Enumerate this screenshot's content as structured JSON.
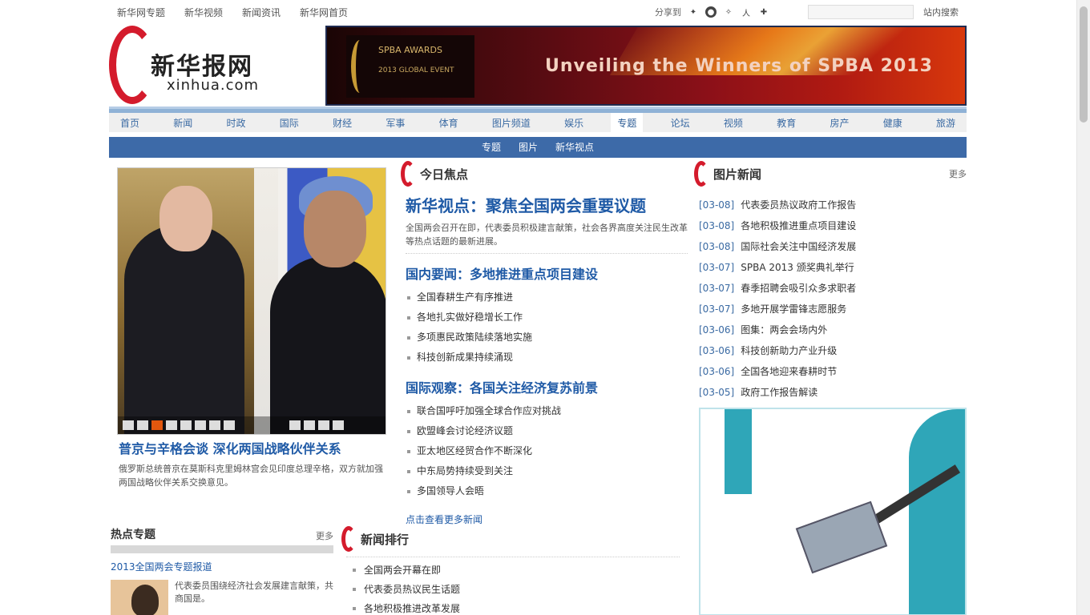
{
  "topbar": {
    "links": [
      "新华网专题",
      "新华视频",
      "新闻资讯",
      "新华网首页"
    ],
    "share_label": "分享到",
    "share_icons": [
      "sina-weibo-icon",
      "qq-icon",
      "tencent-weibo-icon",
      "renren-icon",
      "kaixin-icon"
    ],
    "search_placeholder": "",
    "search_label": "站内搜索"
  },
  "logo": {
    "cn": "新华报网",
    "en": "xinhua.com"
  },
  "banner": {
    "badge_title": "SPBA AWARDS",
    "badge_sub": "2013 GLOBAL EVENT",
    "title": "Unveiling the Winners of SPBA 2013"
  },
  "nav": {
    "items": [
      "首页",
      "新闻",
      "时政",
      "国际",
      "财经",
      "军事",
      "体育",
      "图片频道",
      "娱乐",
      "专题",
      "论坛",
      "视频",
      "教育",
      "房产",
      "健康",
      "旅游"
    ],
    "active": 9
  },
  "subnav": {
    "items": [
      "专题",
      "图片",
      "新华视点"
    ]
  },
  "photo": {
    "caption_title": "普京与辛格会谈 深化两国战略伙伴关系",
    "caption_desc": "俄罗斯总统普京在莫斯科克里姆林宫会见印度总理辛格，双方就加强两国战略伙伴关系交换意见。"
  },
  "center": {
    "section_title": "今日焦点",
    "headline": "新华视点：聚焦全国两会重要议题",
    "summary": "全国两会召开在即，代表委员积极建言献策，社会各界高度关注民生改革等热点话题的最新进展。",
    "sub1": "国内要闻：多地推进重点项目建设",
    "list1": [
      "全国春耕生产有序推进",
      "各地扎实做好稳增长工作",
      "多项惠民政策陆续落地实施",
      "科技创新成果持续涌现"
    ],
    "sub2": "国际观察：各国关注经济复苏前景",
    "list2": [
      "联合国呼吁加强全球合作应对挑战",
      "欧盟峰会讨论经济议题",
      "亚太地区经贸合作不断深化",
      "中东局势持续受到关注",
      "多国领导人会晤"
    ],
    "more": "点击查看更多新闻"
  },
  "right": {
    "section_title": "图片新闻",
    "more": "更多",
    "items": [
      {
        "date": "[03-08]",
        "title": "代表委员热议政府工作报告"
      },
      {
        "date": "[03-08]",
        "title": "各地积极推进重点项目建设"
      },
      {
        "date": "[03-08]",
        "title": "国际社会关注中国经济发展"
      },
      {
        "date": "[03-07]",
        "title": "SPBA 2013 颁奖典礼举行"
      },
      {
        "date": "[03-07]",
        "title": "春季招聘会吸引众多求职者"
      },
      {
        "date": "[03-07]",
        "title": "多地开展学雷锋志愿服务"
      },
      {
        "date": "[03-06]",
        "title": "图集：两会会场内外"
      },
      {
        "date": "[03-06]",
        "title": "科技创新助力产业升级"
      },
      {
        "date": "[03-06]",
        "title": "全国各地迎来春耕时节"
      },
      {
        "date": "[03-05]",
        "title": "政府工作报告解读"
      }
    ]
  },
  "lower_left": {
    "title": "热点专题",
    "more": "更多",
    "link": "2013全国两会专题报道",
    "text": "代表委员围绕经济社会发展建言献策，共商国是。"
  },
  "lower_mid": {
    "section_title": "新闻排行",
    "items": [
      "全国两会开幕在即",
      "代表委员热议民生话题",
      "各地积极推进改革发展"
    ]
  }
}
